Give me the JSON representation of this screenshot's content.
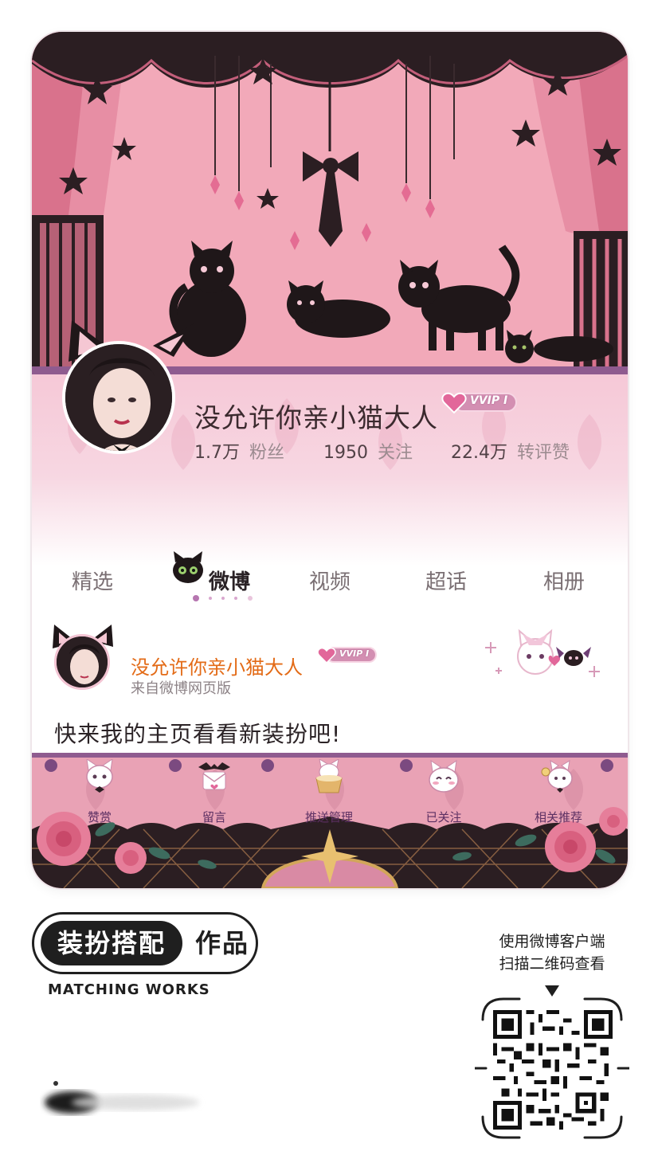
{
  "profile": {
    "name": "没允许你亲小猫大人",
    "vip_badge": "VVIP I",
    "stats": [
      {
        "num": "1.7万",
        "label": "粉丝"
      },
      {
        "num": "1950",
        "label": "关注"
      },
      {
        "num": "22.4万",
        "label": "转评赞"
      }
    ]
  },
  "tabs": [
    {
      "label": "精选"
    },
    {
      "label": "微博",
      "active": true
    },
    {
      "label": "视频"
    },
    {
      "label": "超话"
    },
    {
      "label": "相册"
    }
  ],
  "post": {
    "author": "没允许你亲小猫大人",
    "vip_badge": "VVIP I",
    "source": "来自微博网页版",
    "text": "快来我的主页看看新装扮吧!"
  },
  "actions": [
    {
      "label": "赞赏",
      "icon": "kitty-bow-icon"
    },
    {
      "label": "留言",
      "icon": "bat-letter-icon"
    },
    {
      "label": "推送管理",
      "icon": "kitty-cup-icon"
    },
    {
      "label": "已关注",
      "icon": "kitty-happy-icon"
    },
    {
      "label": "相关推荐",
      "icon": "kitty-mirror-icon"
    }
  ],
  "footer": {
    "brand_black": "装扮搭配",
    "brand_white": "作品",
    "brand_sub": "MATCHING WORKS",
    "qr_hint_line1": "使用微博客户端",
    "qr_hint_line2": "扫描二维码查看"
  },
  "colors": {
    "banner_pink": "#f3aebd",
    "curtain_dark": "#2b1e22",
    "accent_purple": "#8f5b8f",
    "name_orange": "#e36b17"
  }
}
